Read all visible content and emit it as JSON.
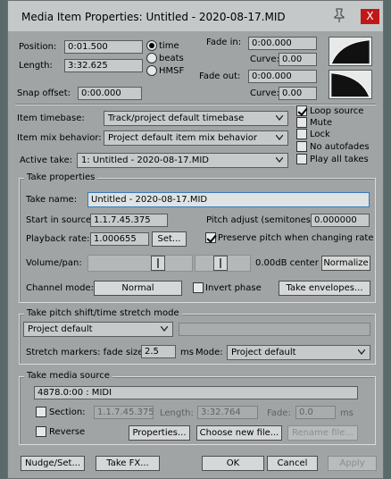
{
  "window": {
    "title": "Media Item Properties:  Untitled - 2020-08-17.MID",
    "close_label": "X"
  },
  "position": {
    "label": "Position:",
    "value": "0:01.500"
  },
  "length": {
    "label": "Length:",
    "value": "3:32.625"
  },
  "timebase_radios": [
    {
      "label": "time",
      "selected": true
    },
    {
      "label": "beats",
      "selected": false
    },
    {
      "label": "HMSF",
      "selected": false
    }
  ],
  "fade_in": {
    "label": "Fade in:",
    "value": "0:00.000",
    "curve_label": "Curve:",
    "curve_value": "0.00"
  },
  "fade_out": {
    "label": "Fade out:",
    "value": "0:00.000",
    "curve_label": "Curve:",
    "curve_value": "0.00"
  },
  "snap_offset": {
    "label": "Snap offset:",
    "value": "0:00.000"
  },
  "item_timebase": {
    "label": "Item timebase:",
    "value": "Track/project default timebase"
  },
  "item_mix": {
    "label": "Item mix behavior:",
    "value": "Project default item mix behavior"
  },
  "active_take": {
    "label": "Active take:",
    "value": "1: Untitled - 2020-08-17.MID"
  },
  "flags": [
    {
      "label": "Loop source",
      "checked": true
    },
    {
      "label": "Mute",
      "checked": false
    },
    {
      "label": "Lock",
      "checked": false
    },
    {
      "label": "No autofades",
      "checked": false
    },
    {
      "label": "Play all takes",
      "checked": false
    }
  ],
  "take_properties": {
    "title": "Take properties",
    "name_label": "Take name:",
    "name_value": "Untitled - 2020-08-17.MID",
    "start_label": "Start in source:",
    "start_value": "1.1.7.45.375",
    "pitch_label": "Pitch adjust (semitones):",
    "pitch_value": "0.000000",
    "rate_label": "Playback rate:",
    "rate_value": "1.000655",
    "set_label": "Set...",
    "preserve_label": "Preserve pitch when changing rate",
    "preserve_checked": true,
    "volpan_label": "Volume/pan:",
    "volpan_readout": "0.00dB center",
    "normalize_label": "Normalize",
    "channel_label": "Channel mode:",
    "channel_value": "Normal",
    "invert_label": "Invert phase",
    "envelopes_label": "Take envelopes..."
  },
  "pitch_shift": {
    "title": "Take pitch shift/time stretch mode",
    "mode_value": "Project default",
    "markers_label": "Stretch markers: fade size:",
    "fade_value": "2.5",
    "ms_label": "ms",
    "mode_label": "Mode:",
    "mode2_value": "Project default"
  },
  "media_source": {
    "title": "Take media source",
    "source_value": "4878.0:00 : MIDI",
    "section_label": "Section:",
    "section_value": "1.1.7.45.375",
    "length_label": "Length:",
    "length_value": "3:32.764",
    "fade_label": "Fade:",
    "fade_value": "0.0",
    "ms_label": "ms",
    "reverse_label": "Reverse",
    "properties_label": "Properties...",
    "choose_label": "Choose new file...",
    "rename_label": "Rename file..."
  },
  "footer": {
    "nudge_label": "Nudge/Set...",
    "takefx_label": "Take FX...",
    "ok_label": "OK",
    "cancel_label": "Cancel",
    "apply_label": "Apply"
  }
}
